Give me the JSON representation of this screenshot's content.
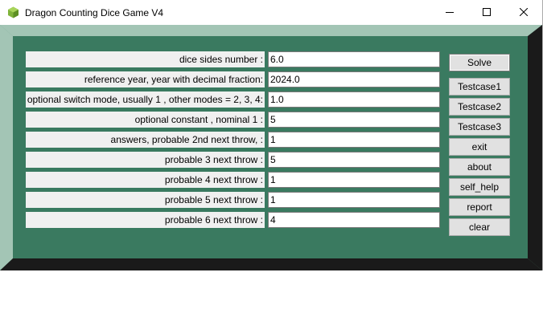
{
  "window": {
    "title": "Dragon Counting Dice Game V4"
  },
  "title_controls": {
    "minimize_icon": "minimize-icon",
    "maximize_icon": "maximize-icon",
    "close_icon": "close-icon"
  },
  "fields": [
    {
      "label": "dice  sides number :",
      "value": "6.0"
    },
    {
      "label": "reference year,  year with decimal fraction:",
      "value": "2024.0"
    },
    {
      "label": "optional switch mode, usually 1 , other modes = 2, 3, 4:",
      "value": "1.0"
    },
    {
      "label": "optional constant , nominal 1 :",
      "value": "5"
    },
    {
      "label": "answers, probable 2nd  next throw,  :",
      "value": "1"
    },
    {
      "label": "probable 3  next  throw :",
      "value": "5"
    },
    {
      "label": "probable 4  next  throw  :",
      "value": "1"
    },
    {
      "label": "probable 5  next  throw  :",
      "value": "1"
    },
    {
      "label": "probable 6  next  throw  :",
      "value": "4"
    }
  ],
  "buttons": {
    "solve": "Solve",
    "testcase1": "Testcase1",
    "testcase2": "Testcase2",
    "testcase3": "Testcase3",
    "exit": "exit",
    "about": "about",
    "self_help": "self_help",
    "report": "report",
    "clear": "clear"
  },
  "colors": {
    "frame_light": "#a3c5b5",
    "frame_medium": "#5e9a80",
    "frame_inner": "#3a7a60",
    "frame_dark": "#1a1a1a",
    "label_bg": "#f0f0f0",
    "button_bg": "#e1e1e1"
  }
}
